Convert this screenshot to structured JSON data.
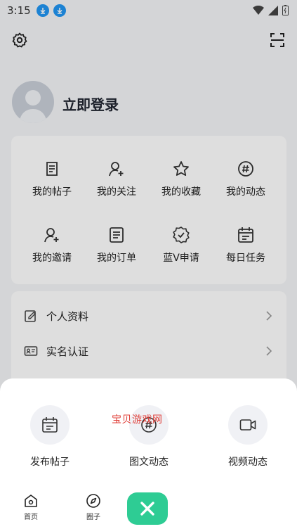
{
  "status_bar": {
    "time": "3:15"
  },
  "profile": {
    "login_label": "立即登录"
  },
  "shortcuts": [
    {
      "label": "我的帖子",
      "icon": "post-icon"
    },
    {
      "label": "我的关注",
      "icon": "follow-icon"
    },
    {
      "label": "我的收藏",
      "icon": "star-icon"
    },
    {
      "label": "我的动态",
      "icon": "hashtag-icon"
    },
    {
      "label": "我的邀请",
      "icon": "invite-icon"
    },
    {
      "label": "我的订单",
      "icon": "order-icon"
    },
    {
      "label": "蓝V申请",
      "icon": "verified-icon"
    },
    {
      "label": "每日任务",
      "icon": "calendar-icon"
    }
  ],
  "menu": [
    {
      "label": "个人资料",
      "icon": "edit-icon"
    },
    {
      "label": "实名认证",
      "icon": "id-card-icon"
    }
  ],
  "sheet": {
    "actions": [
      {
        "label": "发布帖子",
        "icon": "calendar-icon"
      },
      {
        "label": "图文动态",
        "icon": "hashtag-icon"
      },
      {
        "label": "视频动态",
        "icon": "video-icon"
      }
    ],
    "watermark": "宝贝游戏网"
  },
  "tabbar": {
    "items": [
      {
        "label": "首页",
        "icon": "home-icon"
      },
      {
        "label": "圈子",
        "icon": "compass-icon"
      }
    ]
  },
  "colors": {
    "accent": "#2ecc94",
    "download_badge": "#2196f3",
    "watermark": "#e0403a"
  }
}
